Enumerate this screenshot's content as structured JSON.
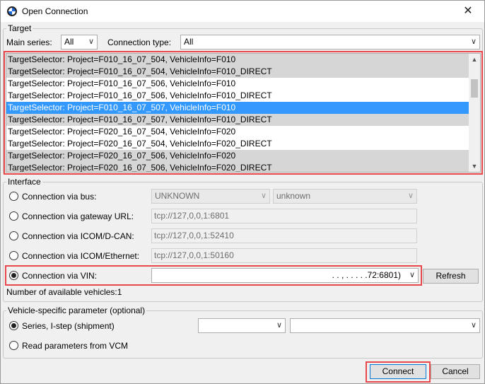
{
  "window": {
    "title": "Open Connection",
    "close_glyph": "✕"
  },
  "target": {
    "legend": "Target",
    "main_series_label": "Main series:",
    "main_series_value": "All",
    "connection_type_label": "Connection type:",
    "connection_type_value": "All",
    "items": [
      {
        "label": "TargetSelector: Project=F010_16_07_504, VehicleInfo=F010",
        "state": "gray"
      },
      {
        "label": "TargetSelector: Project=F010_16_07_504, VehicleInfo=F010_DIRECT",
        "state": "gray"
      },
      {
        "label": "TargetSelector: Project=F010_16_07_506, VehicleInfo=F010",
        "state": "normal"
      },
      {
        "label": "TargetSelector: Project=F010_16_07_506, VehicleInfo=F010_DIRECT",
        "state": "normal"
      },
      {
        "label": "TargetSelector: Project=F010_16_07_507, VehicleInfo=F010",
        "state": "selected"
      },
      {
        "label": "TargetSelector: Project=F010_16_07_507, VehicleInfo=F010_DIRECT",
        "state": "gray"
      },
      {
        "label": "TargetSelector: Project=F020_16_07_504, VehicleInfo=F020",
        "state": "normal"
      },
      {
        "label": "TargetSelector: Project=F020_16_07_504, VehicleInfo=F020_DIRECT",
        "state": "normal"
      },
      {
        "label": "TargetSelector: Project=F020_16_07_506, VehicleInfo=F020",
        "state": "gray"
      },
      {
        "label": "TargetSelector: Project=F020_16_07_506, VehicleInfo=F020_DIRECT",
        "state": "gray"
      }
    ]
  },
  "interface": {
    "legend": "Interface",
    "bus_label": "Connection via bus:",
    "bus_value1": "UNKNOWN",
    "bus_value2": "unknown",
    "gateway_label": "Connection via gateway URL:",
    "gateway_value": "tcp://127,0,0,1:6801",
    "icom_dcan_label": "Connection via ICOM/D-CAN:",
    "icom_dcan_value": "tcp://127,0,0,1:52410",
    "icom_eth_label": "Connection via ICOM/Ethernet:",
    "icom_eth_value": "tcp://127,0,0,1:50160",
    "vin_label": "Connection via VIN:",
    "vin_value": ". . , . .  . . .72:6801)",
    "refresh_label": "Refresh",
    "available_vehicles": "Number of available vehicles:1"
  },
  "vehicle_param": {
    "legend": "Vehicle-specific parameter (optional)",
    "series_label": "Series, I-step (shipment)",
    "series_value": "",
    "istep_value": "",
    "vcm_label": "Read parameters from VCM"
  },
  "buttons": {
    "connect_label": "Connect",
    "cancel_label": "Cancel"
  },
  "colors": {
    "selection": "#3399ff",
    "highlight_box": "#e8474b",
    "gray_row": "#d6d6d6"
  }
}
